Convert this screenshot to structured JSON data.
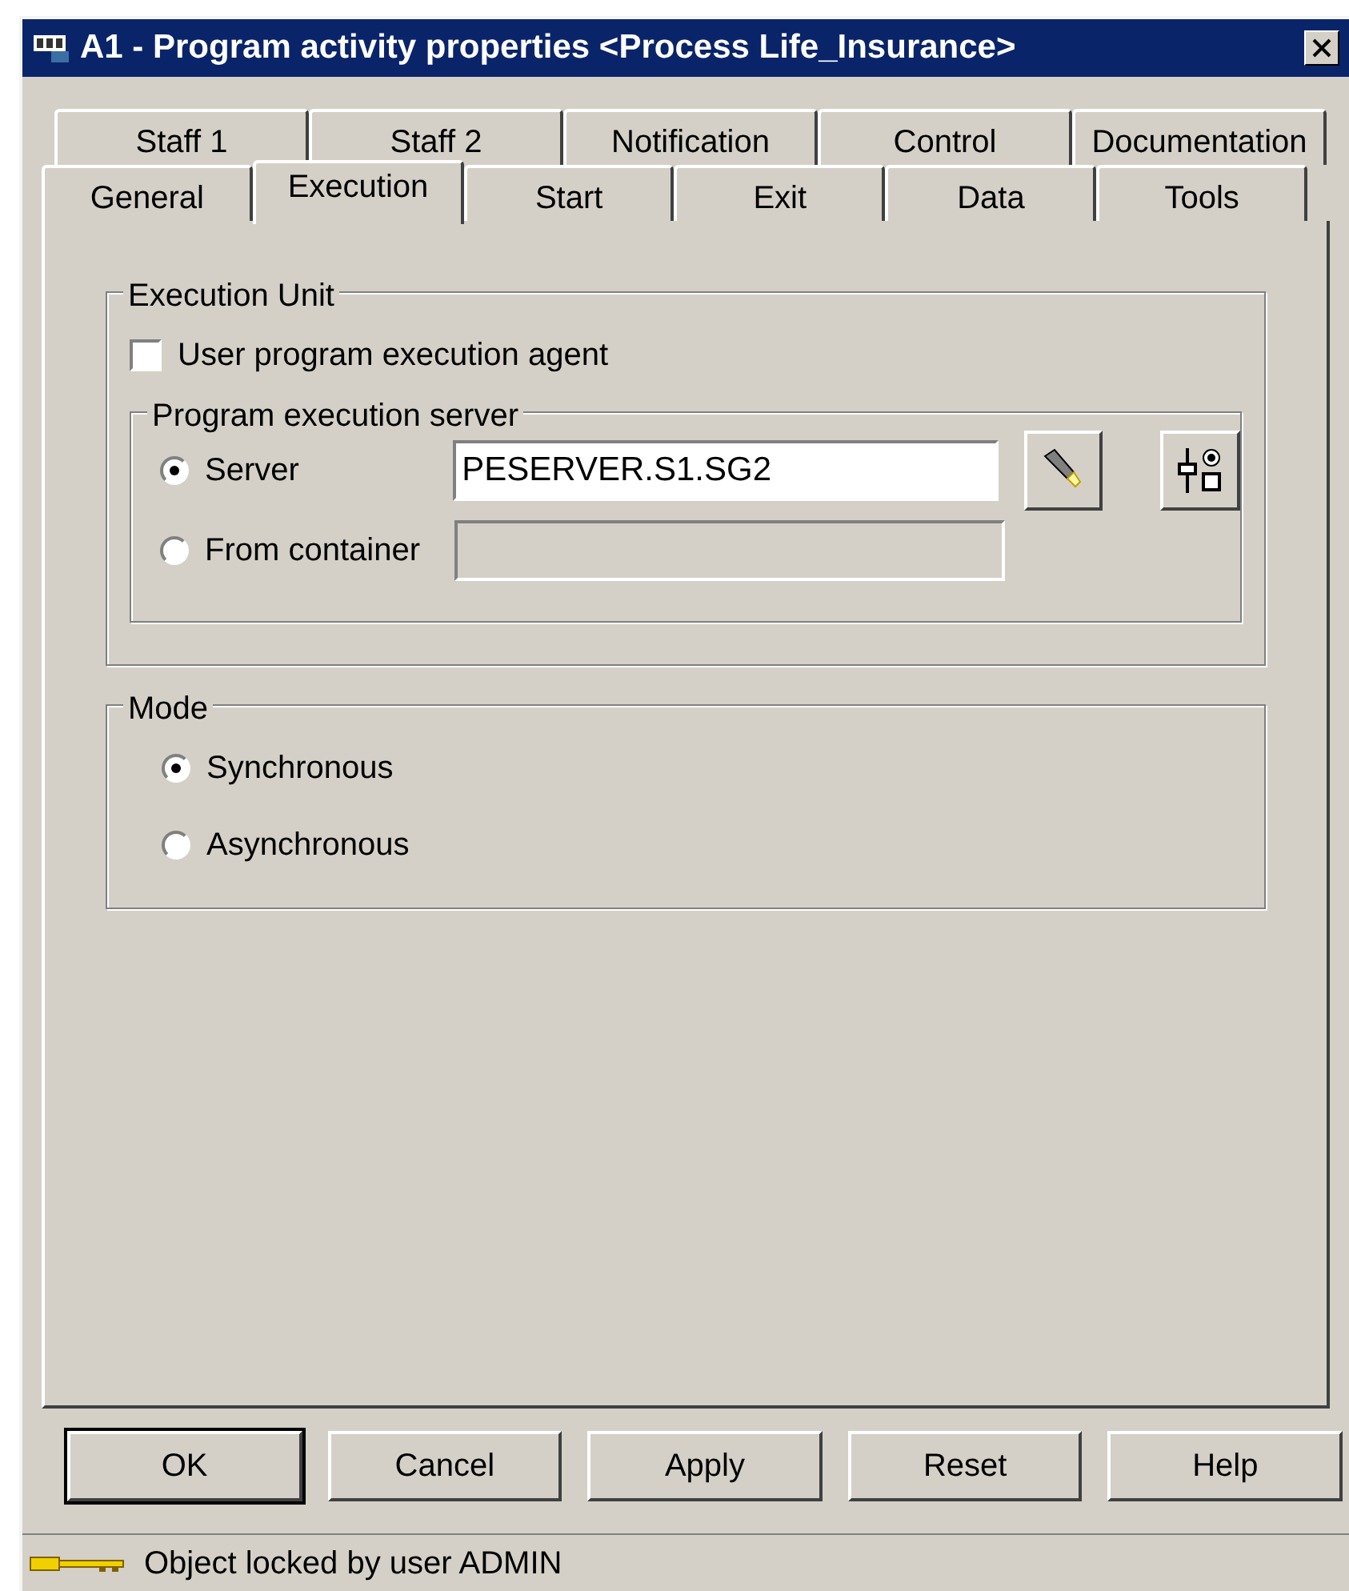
{
  "window": {
    "title": "A1 - Program activity properties <Process Life_Insurance>"
  },
  "tab_rows": [
    {
      "tabs": [
        {
          "label": "Staff 1",
          "selected": false
        },
        {
          "label": "Staff 2",
          "selected": false
        },
        {
          "label": "Notification",
          "selected": false
        },
        {
          "label": "Control",
          "selected": false
        },
        {
          "label": "Documentation",
          "selected": false
        }
      ]
    },
    {
      "tabs": [
        {
          "label": "General",
          "selected": false
        },
        {
          "label": "Execution",
          "selected": true
        },
        {
          "label": "Start",
          "selected": false
        },
        {
          "label": "Exit",
          "selected": false
        },
        {
          "label": "Data",
          "selected": false
        },
        {
          "label": "Tools",
          "selected": false
        }
      ]
    }
  ],
  "execution_unit": {
    "title": "Execution Unit",
    "agent_checkbox": {
      "label": "User program execution agent",
      "checked": false
    },
    "server_group": {
      "title": "Program execution server",
      "options": [
        {
          "label": "Server",
          "selected": true,
          "value": "PESERVER.S1.SG2",
          "enabled": true
        },
        {
          "label": "From container",
          "selected": false,
          "enabled": false
        }
      ]
    }
  },
  "mode": {
    "title": "Mode",
    "options": [
      {
        "label": "Synchronous",
        "selected": true
      },
      {
        "label": "Asynchronous",
        "selected": false
      }
    ]
  },
  "buttons": [
    {
      "label": "OK",
      "default": true
    },
    {
      "label": "Cancel",
      "default": false
    },
    {
      "label": "Apply",
      "default": false
    },
    {
      "label": "Reset",
      "default": false
    },
    {
      "label": "Help",
      "default": false
    }
  ],
  "status_bar": {
    "text": "Object locked by user ADMIN"
  }
}
